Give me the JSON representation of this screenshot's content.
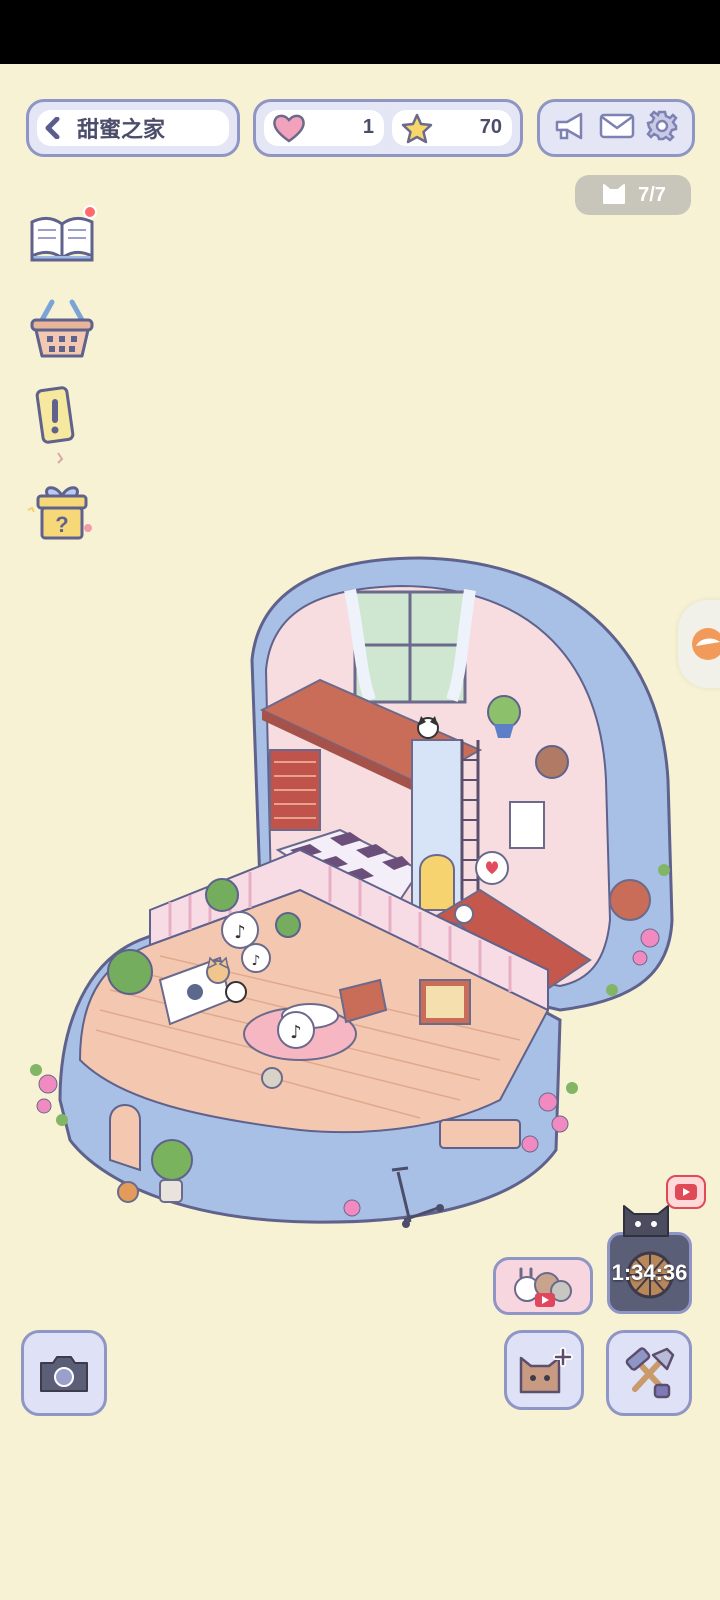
{
  "header": {
    "title": "甜蜜之家",
    "hearts": "1",
    "stars": "70",
    "cat_count": "7/7"
  },
  "timer": {
    "value": "1:34:36"
  },
  "icons": {
    "back": "chevron-left-icon",
    "heart": "heart-icon",
    "star": "star-icon",
    "megaphone": "megaphone-icon",
    "mail": "mail-icon",
    "settings": "gear-icon",
    "cat": "cat-head-icon",
    "book": "book-icon",
    "basket": "basket-icon",
    "quest": "exclamation-card-icon",
    "gift": "mystery-gift-icon",
    "camera": "camera-icon",
    "add_cat": "add-cat-icon",
    "tools": "hammer-shovel-icon",
    "video_ad": "video-play-icon"
  },
  "colors": {
    "background": "#f7f2d3",
    "accent": "#8f95c4",
    "pill_fill": "#e4e6f6",
    "house_shell": "#a9c0e6",
    "notification": "#ff6b6b"
  }
}
